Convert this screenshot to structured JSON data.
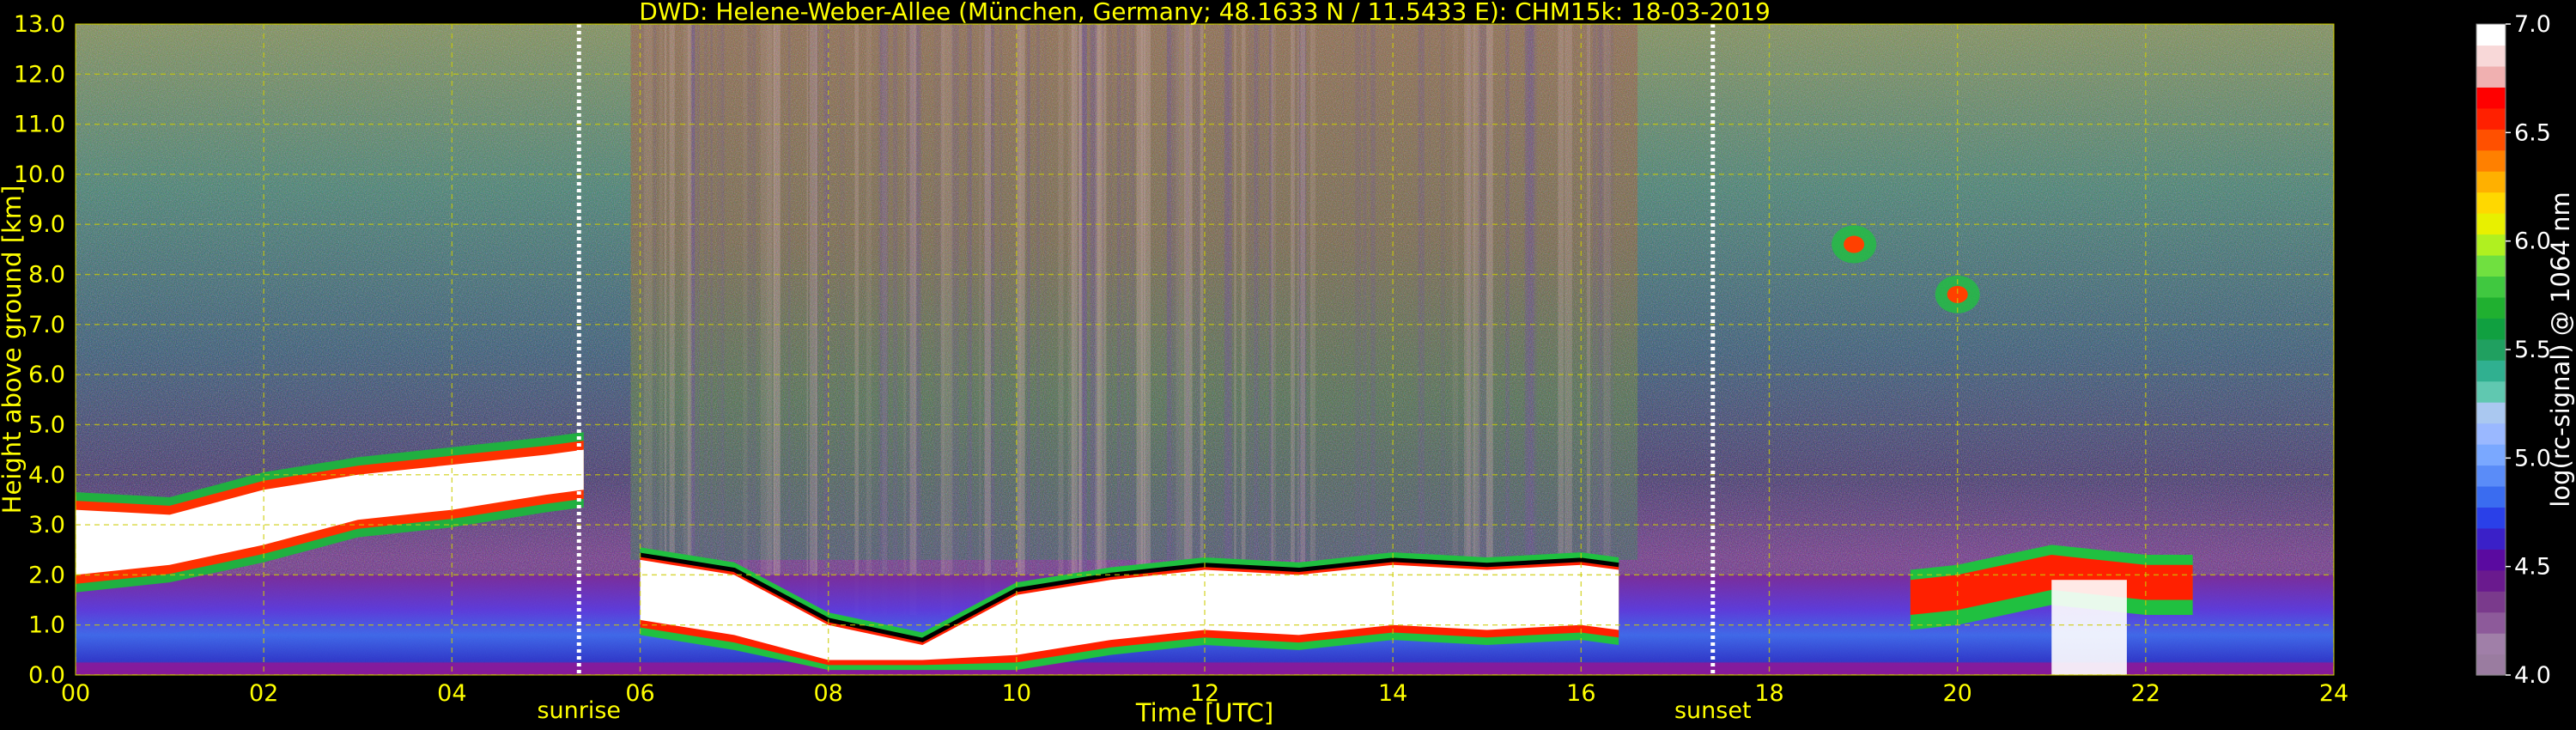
{
  "chart_data": {
    "type": "heatmap",
    "title": "DWD: Helene-Weber-Allee (München, Germany; 48.1633 N / 11.5433 E):    CHM15k: 18-03-2019",
    "xlabel": "Time [UTC]",
    "ylabel": "Height above ground [km]",
    "xlim": [
      0,
      24
    ],
    "ylim": [
      0,
      13
    ],
    "x_ticks": [
      "00",
      "02",
      "04",
      "06",
      "08",
      "10",
      "12",
      "14",
      "16",
      "18",
      "20",
      "22",
      "24"
    ],
    "x_tick_values": [
      0,
      2,
      4,
      6,
      8,
      10,
      12,
      14,
      16,
      18,
      20,
      22,
      24
    ],
    "y_ticks": [
      "0.0",
      "1.0",
      "2.0",
      "3.0",
      "4.0",
      "5.0",
      "6.0",
      "7.0",
      "8.0",
      "9.0",
      "10.0",
      "11.0",
      "12.0",
      "13.0"
    ],
    "y_tick_values": [
      0,
      1,
      2,
      3,
      4,
      5,
      6,
      7,
      8,
      9,
      10,
      11,
      12,
      13
    ],
    "grid": true,
    "colorbar": {
      "label": "log(rc-signal) @ 1064 nm",
      "range": [
        4.0,
        7.0
      ],
      "ticks": [
        "4.0",
        "4.5",
        "5.0",
        "5.5",
        "6.0",
        "6.5",
        "7.0"
      ],
      "tick_values": [
        4.0,
        4.5,
        5.0,
        5.5,
        6.0,
        6.5,
        7.0
      ],
      "colors": [
        "#9a7ca0",
        "#a07fa8",
        "#8d5a9a",
        "#7a3a8c",
        "#6a1a8e",
        "#5a0aa0",
        "#3a20c8",
        "#2a40e8",
        "#3a6cf0",
        "#5a8cf8",
        "#7aa8ff",
        "#9ab8ff",
        "#aac8f0",
        "#60c8b0",
        "#30b090",
        "#20a060",
        "#10a040",
        "#20b030",
        "#40c840",
        "#70e040",
        "#b0f020",
        "#e8f000",
        "#ffd800",
        "#ffb000",
        "#ff8000",
        "#ff5000",
        "#ff2000",
        "#ff0000",
        "#f0b0b0",
        "#f8d8d8",
        "#ffffff"
      ]
    },
    "annotations": [
      {
        "text": "sunrise",
        "x": 5.35
      },
      {
        "text": "sunset",
        "x": 17.4
      }
    ],
    "features": {
      "residual_layer_top_km": [
        [
          0.0,
          3.3
        ],
        [
          1.0,
          3.2
        ],
        [
          2.0,
          3.7
        ],
        [
          3.0,
          4.0
        ],
        [
          4.0,
          4.2
        ],
        [
          5.0,
          4.4
        ],
        [
          5.4,
          4.5
        ]
      ],
      "residual_layer_bottom_km": [
        [
          0.0,
          2.0
        ],
        [
          1.0,
          2.2
        ],
        [
          2.0,
          2.6
        ],
        [
          3.0,
          3.1
        ],
        [
          4.0,
          3.3
        ],
        [
          5.0,
          3.6
        ],
        [
          5.4,
          3.7
        ]
      ],
      "boundary_layer_top_km": [
        [
          6.0,
          2.3
        ],
        [
          7.0,
          2.0
        ],
        [
          8.0,
          1.0
        ],
        [
          9.0,
          0.6
        ],
        [
          10.0,
          1.6
        ],
        [
          11.0,
          1.9
        ],
        [
          12.0,
          2.1
        ],
        [
          13.0,
          2.0
        ],
        [
          14.0,
          2.2
        ],
        [
          15.0,
          2.1
        ],
        [
          16.0,
          2.2
        ],
        [
          16.4,
          2.1
        ]
      ],
      "evening_cloud_top_km": [
        [
          19.5,
          1.9
        ],
        [
          20.0,
          2.0
        ],
        [
          21.0,
          2.4
        ],
        [
          22.0,
          2.2
        ],
        [
          22.5,
          2.2
        ]
      ],
      "high_cloud": [
        {
          "x": 18.9,
          "y": 8.6
        },
        {
          "x": 20.0,
          "y": 7.6
        }
      ]
    }
  }
}
